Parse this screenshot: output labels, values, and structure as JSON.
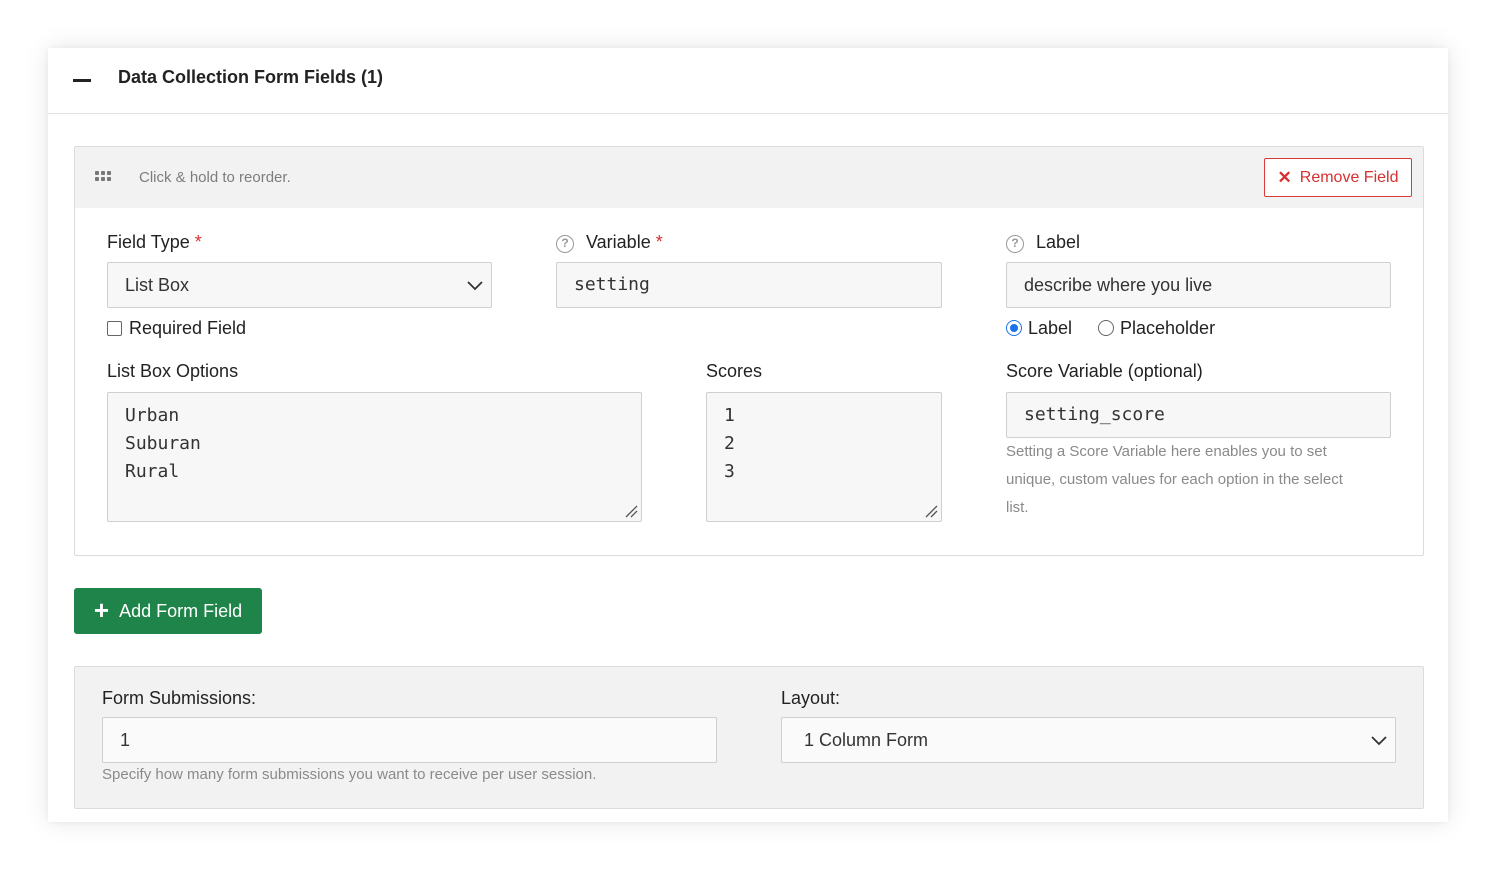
{
  "panel": {
    "title": "Data Collection Form Fields (1)",
    "collapse_icon": "minus-icon"
  },
  "field_card": {
    "reorder_hint": "Click & hold to reorder.",
    "drag_icon": "grip-dots-icon",
    "remove_button": {
      "icon": "close-icon",
      "label": "Remove Field"
    },
    "field_type": {
      "label": "Field Type",
      "required_mark": "*",
      "value": "List Box"
    },
    "required_field": {
      "label": "Required Field",
      "checked": false
    },
    "variable": {
      "label": "Variable",
      "required_mark": "*",
      "help_icon": "question-circle-icon",
      "value": "setting"
    },
    "label_field": {
      "label": "Label",
      "help_icon": "question-circle-icon",
      "value": "describe where you live"
    },
    "label_mode": {
      "selected": "Label",
      "options": [
        "Label",
        "Placeholder"
      ]
    },
    "list_box_options": {
      "label": "List Box Options",
      "lines": [
        "Urban",
        "Suburan",
        "Rural"
      ]
    },
    "scores": {
      "label": "Scores",
      "lines": [
        "1",
        "2",
        "3"
      ]
    },
    "score_variable": {
      "label": "Score Variable (optional)",
      "value": "setting_score",
      "help_lines": [
        "Setting a Score Variable here enables you to set",
        "unique, custom values for each option in the select",
        "list."
      ]
    }
  },
  "add_button": {
    "icon": "plus-icon",
    "label": "Add Form Field"
  },
  "settings": {
    "submissions": {
      "label": "Form Submissions:",
      "value": "1",
      "help": "Specify how many form submissions you want to receive per user session."
    },
    "layout": {
      "label": "Layout:",
      "value": "1 Column Form"
    }
  },
  "colors": {
    "remove": "#d63031",
    "add": "#1e8449",
    "radio": "#1a73e8"
  }
}
